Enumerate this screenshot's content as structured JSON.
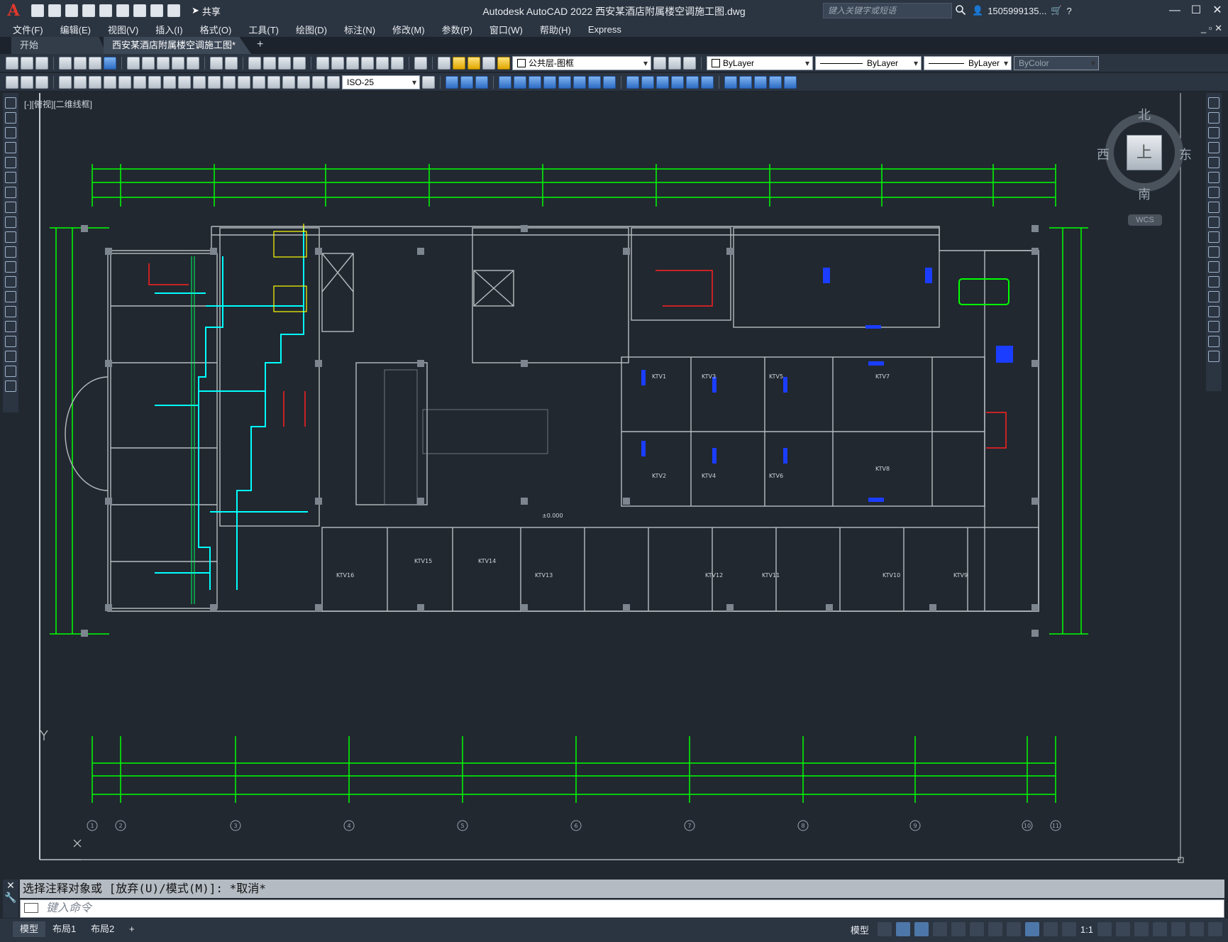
{
  "app": {
    "logo": "A",
    "share_label": "共享",
    "window_title": "Autodesk AutoCAD 2022    西安某酒店附属楼空调施工图.dwg",
    "search_placeholder": "键入关键字或短语",
    "user": "1505999135...",
    "window_controls": [
      "—",
      "☐",
      "✕"
    ]
  },
  "menu": {
    "items": [
      "文件(F)",
      "编辑(E)",
      "视图(V)",
      "插入(I)",
      "格式(O)",
      "工具(T)",
      "绘图(D)",
      "标注(N)",
      "修改(M)",
      "参数(P)",
      "窗口(W)",
      "帮助(H)",
      "Express"
    ]
  },
  "tabs": {
    "start": "开始",
    "active": "西安某酒店附属楼空调施工图*",
    "close": "✕",
    "add": "+"
  },
  "toolbar": {
    "layer_name": "公共层-图框",
    "color": "ByLayer",
    "linetype": "ByLayer",
    "lineweight": "ByLayer",
    "plotstyle": "ByColor",
    "dimstyle": "ISO-25"
  },
  "viewport": {
    "label": "[-][俯视][二维线框]"
  },
  "viewcube": {
    "north": "北",
    "south": "南",
    "east": "东",
    "west": "西",
    "face": "上",
    "wcs": "WCS"
  },
  "drawing": {
    "rooms": {
      "ktv": [
        "KTV1",
        "KTV2",
        "KTV3",
        "KTV4",
        "KTV5",
        "KTV6",
        "KTV7",
        "KTV8",
        "KTV9",
        "KTV10",
        "KTV11",
        "KTV12",
        "KTV13",
        "KTV14",
        "KTV15",
        "KTV16"
      ]
    },
    "grid_labels": [
      "1",
      "2",
      "3",
      "4",
      "5",
      "6",
      "7",
      "8",
      "9",
      "10",
      "11"
    ],
    "elevation": "±0.000"
  },
  "command": {
    "history": "选择注释对象或 [放弃(U)/模式(M)]: *取消*",
    "placeholder": "键入命令"
  },
  "status": {
    "layouts": [
      "模型",
      "布局1",
      "布局2"
    ],
    "add": "+",
    "model": "模型",
    "scale": "1:1"
  },
  "colors": {
    "background": "#212830",
    "dimension": "#00ff00",
    "wall": "#b8bcc0",
    "duct": "#00ffff",
    "accent_red": "#ff2020"
  }
}
